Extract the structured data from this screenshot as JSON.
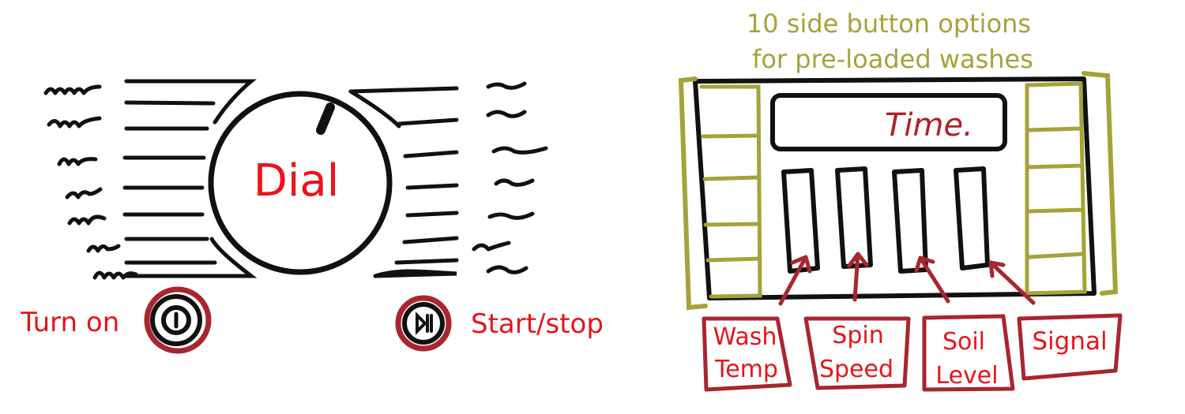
{
  "left_panel": {
    "dial_label": "Dial",
    "turn_on_label": "Turn on",
    "start_stop_label": "Start/stop"
  },
  "right_panel": {
    "side_buttons_title_line1": "10 side button options",
    "side_buttons_title_line2": "for pre-loaded washes",
    "display_label": "Time.",
    "controls": [
      {
        "line1": "Wash",
        "line2": "Temp"
      },
      {
        "line1": "Spin",
        "line2": "Speed"
      },
      {
        "line1": "Soil",
        "line2": "Level"
      },
      {
        "line1": "Signal",
        "line2": ""
      }
    ]
  },
  "colors": {
    "ink": "#111111",
    "label_red": "#e8141a",
    "accent_dark_red": "#a8262e",
    "olive": "#a6a23a"
  }
}
